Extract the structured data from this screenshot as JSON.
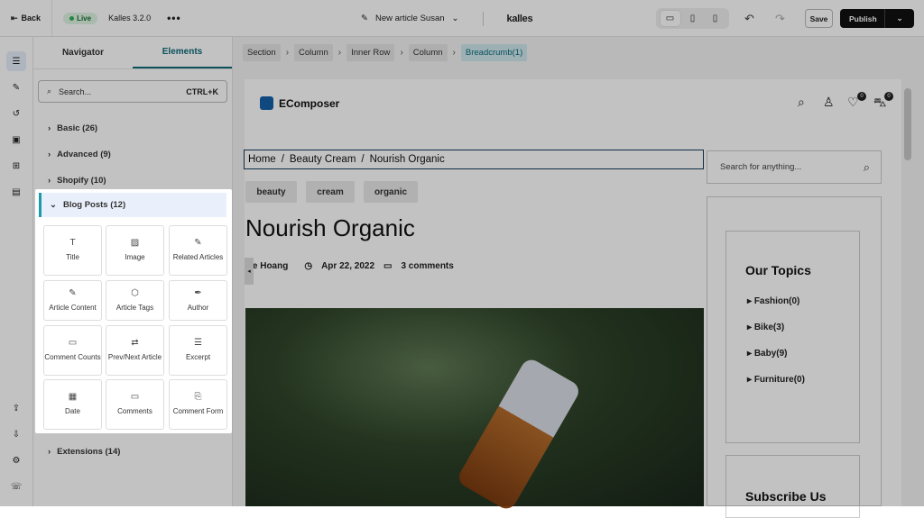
{
  "topbar": {
    "back_label": "Back",
    "live_label": "Live",
    "theme_name": "Kalles 3.2.0",
    "more": "•••",
    "page_title": "New article Susan",
    "brand": "kalles",
    "save_label": "Save",
    "publish_label": "Publish"
  },
  "panel": {
    "tabs": [
      "Navigator",
      "Elements"
    ],
    "search_placeholder": "Search...",
    "search_shortcut": "CTRL+K",
    "categories": {
      "basic": "Basic (26)",
      "advanced": "Advanced (9)",
      "shopify": "Shopify (10)",
      "blog_posts": "Blog Posts (12)",
      "extensions": "Extensions (14)"
    },
    "blog_elements": [
      "Title",
      "Image",
      "Related Articles",
      "Article Content",
      "Article Tags",
      "Author",
      "Comment Counts",
      "Prev/Next Article",
      "Excerpt",
      "Date",
      "Comments",
      "Comment Form"
    ]
  },
  "canvas": {
    "crumbs": [
      "Section",
      "Column",
      "Inner Row",
      "Column",
      "Breadcrumb(1)"
    ],
    "logo": "EComposer",
    "wishlist_count": "0",
    "cart_count": "0",
    "breadcrumb": {
      "home": "Home",
      "cat": "Beauty Cream",
      "current": "Nourish Organic",
      "sep": "/"
    },
    "tags": [
      "beauty",
      "cream",
      "organic"
    ],
    "article_title": "Nourish Organic",
    "author": "ate Hoang",
    "date": "Apr 22, 2022",
    "comments": "3 comments",
    "sidebar_search_placeholder": "Search for anything...",
    "topics_title": "Our Topics",
    "topics": [
      "Fashion(0)",
      "Bike(3)",
      "Baby(9)",
      "Furniture(0)"
    ],
    "subscribe_title": "Subscribe Us"
  }
}
